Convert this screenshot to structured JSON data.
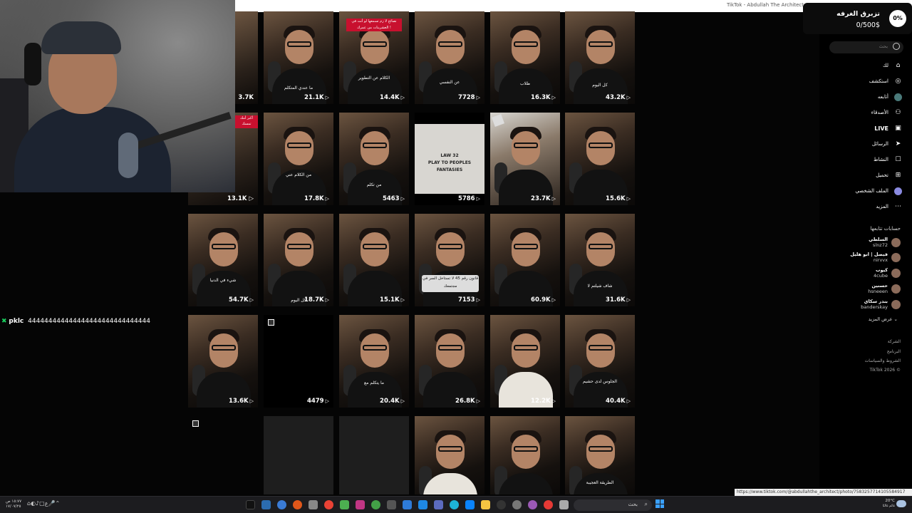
{
  "window": {
    "title": "TikTok - Abdullah The Architect"
  },
  "goal": {
    "title": "تزبرق الغرفه",
    "amount": "0/500$",
    "percent": "0%"
  },
  "search": {
    "placeholder": "بحث"
  },
  "nav": [
    {
      "label": "لك",
      "icon": "home-icon"
    },
    {
      "label": "استكشف",
      "icon": "compass-icon"
    },
    {
      "label": "أتابعه",
      "icon": "avatar-icon"
    },
    {
      "label": "الأصدقاء",
      "icon": "friends-icon"
    },
    {
      "label": "LIVE",
      "icon": "live-icon"
    },
    {
      "label": "الرسائل",
      "icon": "send-icon"
    },
    {
      "label": "النشاط",
      "icon": "inbox-icon"
    },
    {
      "label": "تحميل",
      "icon": "upload-icon"
    },
    {
      "label": "الملف الشخصي",
      "icon": "profile-avatar-icon"
    },
    {
      "label": "المزيد",
      "icon": "more-icon"
    }
  ],
  "following": {
    "title": "حسابات تتابعها",
    "accounts": [
      {
        "display": "السلطي",
        "username": "slnz72"
      },
      {
        "display": "فيصل | ابو هليل",
        "username": "nirvvx"
      },
      {
        "display": "كيوب",
        "username": "4cube"
      },
      {
        "display": "حسنين",
        "username": "hsneeen"
      },
      {
        "display": "بندر سكاي",
        "username": "banderskay"
      }
    ],
    "show_more": "عرض المزيد"
  },
  "footer": [
    "الشركة",
    "البرنامج",
    "الشروط والسياسات",
    "TikTok 2026 ©"
  ],
  "chat": {
    "badge": "✖",
    "user": "pklc",
    "message": "444444444444444444444444444444"
  },
  "videos": {
    "row0": [
      "3.7K",
      "21.1K",
      "14.4K",
      "7728",
      "16.3K",
      "43.2K"
    ],
    "row1": [
      "13.1K",
      "17.8K",
      "5463",
      "5786",
      "23.7K",
      "15.6K"
    ],
    "row2": [
      "54.7K",
      "18.7K",
      "15.1K",
      "7153",
      "60.9K",
      "31.6K"
    ],
    "row3": [
      "13.6K",
      "4479",
      "20.4K",
      "26.8K",
      "12.2K",
      "40.4K"
    ]
  },
  "captions": {
    "c01": "ما عندي المتكلم",
    "c02": "الكلام عن التطوير",
    "c03": "عن النفسي",
    "c04": "طلاب",
    "c05": "كل اليوم",
    "c12": "من الكلام عني",
    "c13": "من تكلم",
    "c20": "شيء في الدنيا",
    "c21": "كل اليوم",
    "c25": "شاف شيلتم لا",
    "c32": "ما يتكلم مع",
    "c35": "الجلوس لدى حشيم",
    "c45": "الطريقة العجيبة",
    "red_label": "نصائح لا زم تسمعها لو أنت في العشرينات من عمرك !",
    "white_label": "قانون رقم 45 لا تستاخل السر في مجتمعك",
    "law_line1": "LAW 32",
    "law_line2": "PLAY TO PEOPLES FANTASIES",
    "partial_red": "أكبر أمك تمسك"
  },
  "url_status": "https://www.tiktok.com/@abdullahthe_architect/photo/7583257714105584917",
  "taskbar": {
    "time": "١٥:٧٧ ص",
    "date": "١٧/٠٧/٢٥",
    "search_label": "بحث",
    "weather": "20°C",
    "weather_desc": "غائم غالبًا"
  }
}
